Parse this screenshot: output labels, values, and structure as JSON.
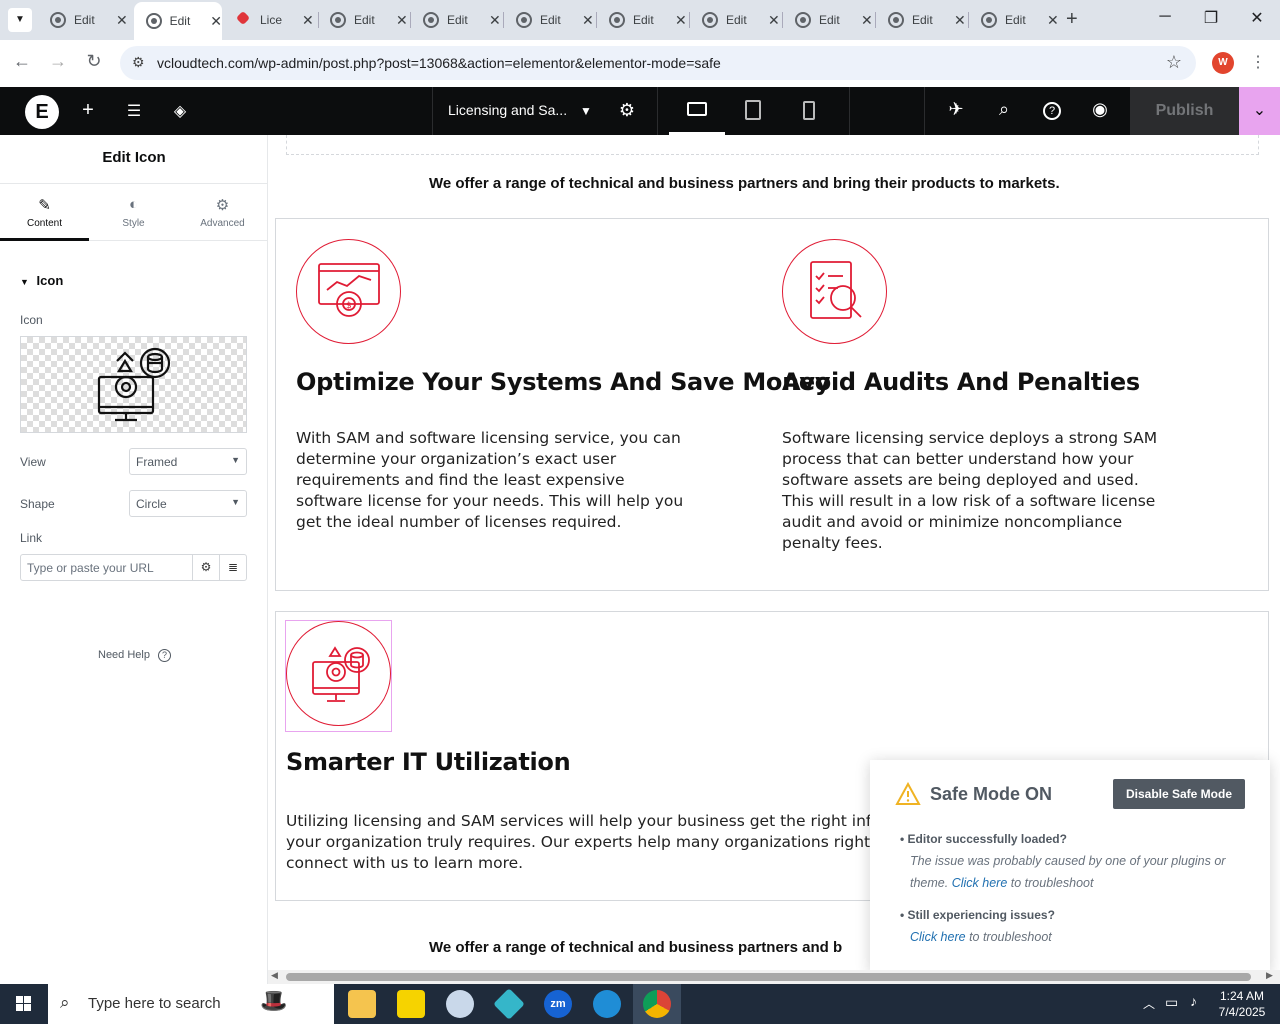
{
  "browser": {
    "tabs": [
      {
        "title": "Edit",
        "icon": "globe-icon"
      },
      {
        "title": "Edit",
        "icon": "globe-icon",
        "active": true
      },
      {
        "title": "Lice",
        "icon": "diamond-icon"
      },
      {
        "title": "Edit",
        "icon": "globe-icon"
      },
      {
        "title": "Edit",
        "icon": "globe-icon"
      },
      {
        "title": "Edit",
        "icon": "globe-icon"
      },
      {
        "title": "Edit",
        "icon": "globe-icon"
      },
      {
        "title": "Edit",
        "icon": "globe-icon"
      },
      {
        "title": "Edit",
        "icon": "globe-icon"
      },
      {
        "title": "Edit",
        "icon": "globe-icon"
      },
      {
        "title": "Edit",
        "icon": "globe-icon"
      }
    ],
    "url": "vcloudtech.com/wp-admin/post.php?post=13068&action=elementor&elementor-mode=safe",
    "profile_initial": "W"
  },
  "topbar": {
    "doc_title": "Licensing and Sa...",
    "publish_label": "Publish"
  },
  "panel": {
    "title": "Edit Icon",
    "tabs": [
      {
        "label": "Content",
        "icon": "pencil-icon"
      },
      {
        "label": "Style",
        "icon": "half-circle-icon"
      },
      {
        "label": "Advanced",
        "icon": "gear-icon"
      }
    ],
    "section": "Icon",
    "icon_label": "Icon",
    "view_label": "View",
    "view_value": "Framed",
    "shape_label": "Shape",
    "shape_value": "Circle",
    "link_label": "Link",
    "link_placeholder": "Type or paste your URL",
    "need_help": "Need Help"
  },
  "canvas": {
    "partner_line": "We offer a range of technical and business partners and bring their products to markets.",
    "partner_line_bottom": "We offer a range of technical and business partners and b",
    "features": [
      {
        "title": "Optimize Your Systems And Save Money",
        "body": "With SAM and software licensing service, you can determine your organization’s exact user requirements and find the least expensive software license for your needs. This will help you get the ideal number of licenses required."
      },
      {
        "title": "Avoid Audits And Penalties",
        "body": "Software licensing service deploys a strong SAM process that can better understand how your software assets are being deployed and used. This will result in a low risk of a software license audit and avoid or minimize noncompliance penalty fees."
      },
      {
        "title": "Smarter IT Utilization",
        "body": "Utilizing licensing and SAM services will help your business get the right info your organization truly requires. Our experts help many organizations right- connect with us to learn more."
      }
    ]
  },
  "safe_mode": {
    "title": "Safe Mode ON",
    "disable_label": "Disable Safe Mode",
    "q1": "Editor successfully loaded?",
    "a1_pre": "The issue was probably caused by one of your plugins or theme.",
    "a1_link": "Click here",
    "a1_post": "to troubleshoot",
    "q2": "Still experiencing issues?",
    "a2_link": "Click here",
    "a2_post": "to troubleshoot"
  },
  "taskbar": {
    "search_placeholder": "Type here to search",
    "time": "1:24 AM",
    "date": "7/4/2025"
  },
  "colors": {
    "accent_red": "#e01c35",
    "elementor_pink": "#e8a4ef",
    "topbar_bg": "#0c0d0e"
  }
}
